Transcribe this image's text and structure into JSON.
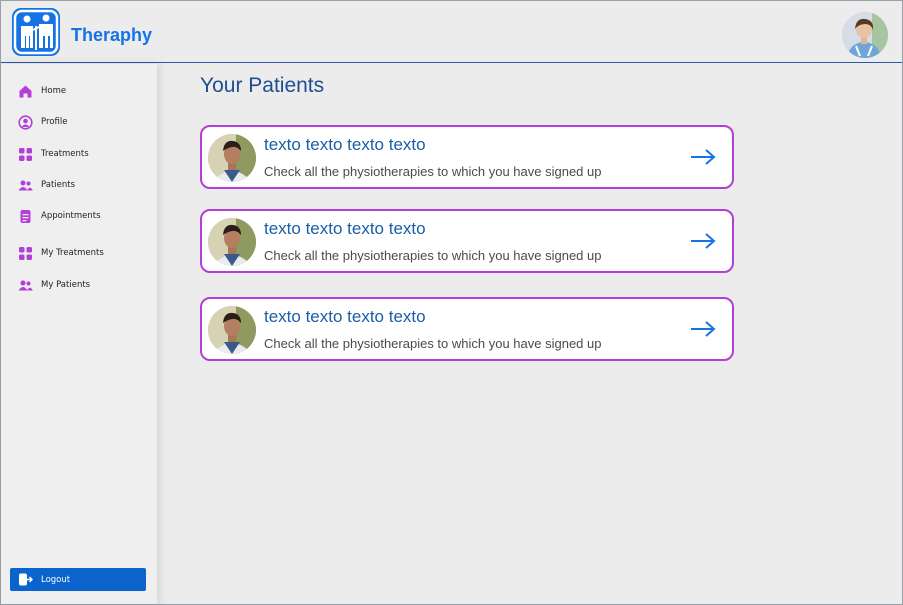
{
  "app": {
    "name": "Theraphy"
  },
  "sidebar": {
    "items": [
      {
        "label": "Home",
        "icon": "home-icon"
      },
      {
        "label": "Profile",
        "icon": "user-circle-icon"
      },
      {
        "label": "Treatments",
        "icon": "grid-icon"
      },
      {
        "label": "Patients",
        "icon": "users-icon"
      },
      {
        "label": "Appointments",
        "icon": "document-icon"
      },
      {
        "label": "My Treatments",
        "icon": "grid-icon"
      },
      {
        "label": "My Patients",
        "icon": "users-icon"
      }
    ],
    "logout_label": "Logout"
  },
  "main": {
    "title": "Your Patients",
    "patients": [
      {
        "name": "texto texto texto texto",
        "description": "Check all the physiotherapies to which you have signed up"
      },
      {
        "name": "texto texto texto texto",
        "description": "Check all the physiotherapies to which you have signed up"
      },
      {
        "name": "texto texto texto texto",
        "description": "Check all the physiotherapies to which you have signed up"
      }
    ]
  },
  "colors": {
    "brand": "#1573e6",
    "accent_purple": "#b43fd8",
    "title_blue": "#1e4f8f",
    "logout_bg": "#0b63ce"
  }
}
